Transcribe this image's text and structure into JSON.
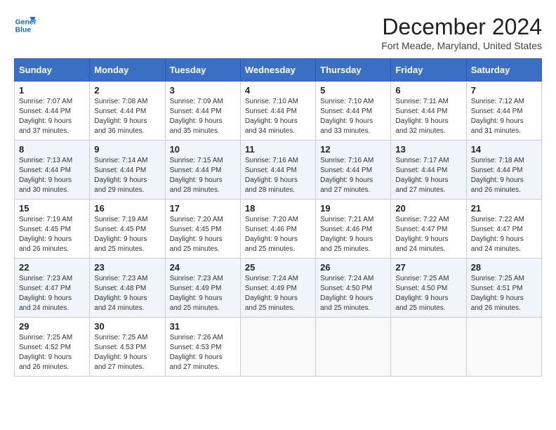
{
  "header": {
    "logo_line1": "General",
    "logo_line2": "Blue",
    "month_title": "December 2024",
    "location": "Fort Meade, Maryland, United States"
  },
  "weekdays": [
    "Sunday",
    "Monday",
    "Tuesday",
    "Wednesday",
    "Thursday",
    "Friday",
    "Saturday"
  ],
  "weeks": [
    [
      {
        "day": "1",
        "sunrise": "7:07 AM",
        "sunset": "4:44 PM",
        "daylight": "9 hours and 37 minutes."
      },
      {
        "day": "2",
        "sunrise": "7:08 AM",
        "sunset": "4:44 PM",
        "daylight": "9 hours and 36 minutes."
      },
      {
        "day": "3",
        "sunrise": "7:09 AM",
        "sunset": "4:44 PM",
        "daylight": "9 hours and 35 minutes."
      },
      {
        "day": "4",
        "sunrise": "7:10 AM",
        "sunset": "4:44 PM",
        "daylight": "9 hours and 34 minutes."
      },
      {
        "day": "5",
        "sunrise": "7:10 AM",
        "sunset": "4:44 PM",
        "daylight": "9 hours and 33 minutes."
      },
      {
        "day": "6",
        "sunrise": "7:11 AM",
        "sunset": "4:44 PM",
        "daylight": "9 hours and 32 minutes."
      },
      {
        "day": "7",
        "sunrise": "7:12 AM",
        "sunset": "4:44 PM",
        "daylight": "9 hours and 31 minutes."
      }
    ],
    [
      {
        "day": "8",
        "sunrise": "7:13 AM",
        "sunset": "4:44 PM",
        "daylight": "9 hours and 30 minutes."
      },
      {
        "day": "9",
        "sunrise": "7:14 AM",
        "sunset": "4:44 PM",
        "daylight": "9 hours and 29 minutes."
      },
      {
        "day": "10",
        "sunrise": "7:15 AM",
        "sunset": "4:44 PM",
        "daylight": "9 hours and 28 minutes."
      },
      {
        "day": "11",
        "sunrise": "7:16 AM",
        "sunset": "4:44 PM",
        "daylight": "9 hours and 28 minutes."
      },
      {
        "day": "12",
        "sunrise": "7:16 AM",
        "sunset": "4:44 PM",
        "daylight": "9 hours and 27 minutes."
      },
      {
        "day": "13",
        "sunrise": "7:17 AM",
        "sunset": "4:44 PM",
        "daylight": "9 hours and 27 minutes."
      },
      {
        "day": "14",
        "sunrise": "7:18 AM",
        "sunset": "4:44 PM",
        "daylight": "9 hours and 26 minutes."
      }
    ],
    [
      {
        "day": "15",
        "sunrise": "7:19 AM",
        "sunset": "4:45 PM",
        "daylight": "9 hours and 26 minutes."
      },
      {
        "day": "16",
        "sunrise": "7:19 AM",
        "sunset": "4:45 PM",
        "daylight": "9 hours and 25 minutes."
      },
      {
        "day": "17",
        "sunrise": "7:20 AM",
        "sunset": "4:45 PM",
        "daylight": "9 hours and 25 minutes."
      },
      {
        "day": "18",
        "sunrise": "7:20 AM",
        "sunset": "4:46 PM",
        "daylight": "9 hours and 25 minutes."
      },
      {
        "day": "19",
        "sunrise": "7:21 AM",
        "sunset": "4:46 PM",
        "daylight": "9 hours and 25 minutes."
      },
      {
        "day": "20",
        "sunrise": "7:22 AM",
        "sunset": "4:47 PM",
        "daylight": "9 hours and 24 minutes."
      },
      {
        "day": "21",
        "sunrise": "7:22 AM",
        "sunset": "4:47 PM",
        "daylight": "9 hours and 24 minutes."
      }
    ],
    [
      {
        "day": "22",
        "sunrise": "7:23 AM",
        "sunset": "4:47 PM",
        "daylight": "9 hours and 24 minutes."
      },
      {
        "day": "23",
        "sunrise": "7:23 AM",
        "sunset": "4:48 PM",
        "daylight": "9 hours and 24 minutes."
      },
      {
        "day": "24",
        "sunrise": "7:23 AM",
        "sunset": "4:49 PM",
        "daylight": "9 hours and 25 minutes."
      },
      {
        "day": "25",
        "sunrise": "7:24 AM",
        "sunset": "4:49 PM",
        "daylight": "9 hours and 25 minutes."
      },
      {
        "day": "26",
        "sunrise": "7:24 AM",
        "sunset": "4:50 PM",
        "daylight": "9 hours and 25 minutes."
      },
      {
        "day": "27",
        "sunrise": "7:25 AM",
        "sunset": "4:50 PM",
        "daylight": "9 hours and 25 minutes."
      },
      {
        "day": "28",
        "sunrise": "7:25 AM",
        "sunset": "4:51 PM",
        "daylight": "9 hours and 26 minutes."
      }
    ],
    [
      {
        "day": "29",
        "sunrise": "7:25 AM",
        "sunset": "4:52 PM",
        "daylight": "9 hours and 26 minutes."
      },
      {
        "day": "30",
        "sunrise": "7:25 AM",
        "sunset": "4:53 PM",
        "daylight": "9 hours and 27 minutes."
      },
      {
        "day": "31",
        "sunrise": "7:26 AM",
        "sunset": "4:53 PM",
        "daylight": "9 hours and 27 minutes."
      },
      null,
      null,
      null,
      null
    ]
  ]
}
